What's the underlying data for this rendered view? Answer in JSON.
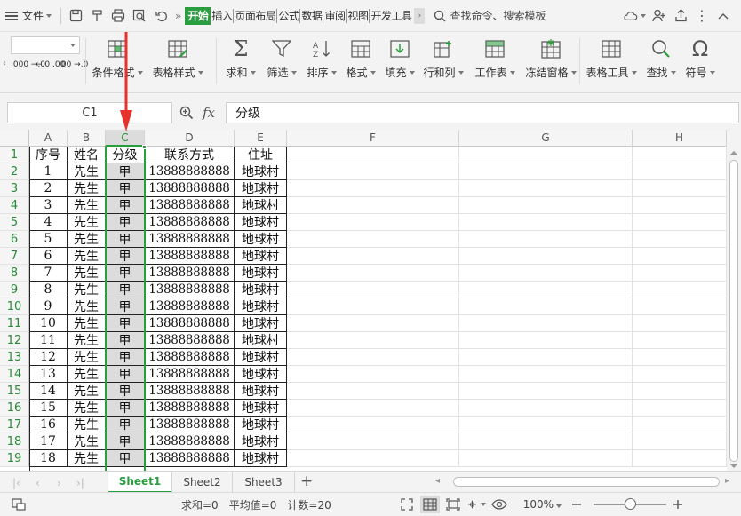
{
  "menubar": {
    "file_label": "文件",
    "tabs": [
      "开始",
      "插入",
      "页面布局",
      "公式",
      "数据",
      "审阅",
      "视图",
      "开发工具"
    ],
    "active_tab": "开始",
    "more": "»",
    "search_label": "查找命令、搜索模板"
  },
  "ribbon": {
    "num_formats": [
      ".000 →.0",
      "←.0 .00",
      ".00 →.0"
    ],
    "buttons": [
      {
        "id": "conditional-format",
        "label": "条件格式",
        "icon": "conditional-format-icon"
      },
      {
        "id": "table-style",
        "label": "表格样式",
        "icon": "table-style-icon"
      },
      {
        "id": "sum",
        "label": "求和",
        "icon": "sigma-icon"
      },
      {
        "id": "filter",
        "label": "筛选",
        "icon": "filter-icon"
      },
      {
        "id": "sort",
        "label": "排序",
        "icon": "sort-icon"
      },
      {
        "id": "format",
        "label": "格式",
        "icon": "format-icon"
      },
      {
        "id": "fill",
        "label": "填充",
        "icon": "fill-icon"
      },
      {
        "id": "row-col",
        "label": "行和列",
        "icon": "row-col-icon"
      },
      {
        "id": "worksheet",
        "label": "工作表",
        "icon": "worksheet-icon"
      },
      {
        "id": "freeze",
        "label": "冻结窗格",
        "icon": "freeze-icon"
      },
      {
        "id": "table-tools",
        "label": "表格工具",
        "icon": "table-tools-icon"
      },
      {
        "id": "find",
        "label": "查找",
        "icon": "magnifier-icon"
      },
      {
        "id": "symbol",
        "label": "符号",
        "icon": "omega-icon"
      }
    ]
  },
  "formula_bar": {
    "cell_ref": "C1",
    "fx_label": "fx",
    "value": "分级"
  },
  "grid": {
    "columns": [
      "A",
      "B",
      "C",
      "D",
      "E",
      "F",
      "G",
      "H"
    ],
    "selected_column": "C",
    "row_numbers": [
      "1",
      "2",
      "3",
      "4",
      "5",
      "6",
      "7",
      "8",
      "9",
      "10",
      "11",
      "12",
      "13",
      "14",
      "15",
      "16",
      "17",
      "18",
      "19"
    ],
    "header_row": [
      "序号",
      "姓名",
      "分级",
      "联系方式",
      "住址"
    ],
    "rows": [
      [
        "1",
        "先生",
        "甲",
        "13888888888",
        "地球村"
      ],
      [
        "2",
        "先生",
        "甲",
        "13888888888",
        "地球村"
      ],
      [
        "3",
        "先生",
        "甲",
        "13888888888",
        "地球村"
      ],
      [
        "4",
        "先生",
        "甲",
        "13888888888",
        "地球村"
      ],
      [
        "5",
        "先生",
        "甲",
        "13888888888",
        "地球村"
      ],
      [
        "6",
        "先生",
        "甲",
        "13888888888",
        "地球村"
      ],
      [
        "7",
        "先生",
        "甲",
        "13888888888",
        "地球村"
      ],
      [
        "8",
        "先生",
        "甲",
        "13888888888",
        "地球村"
      ],
      [
        "9",
        "先生",
        "甲",
        "13888888888",
        "地球村"
      ],
      [
        "10",
        "先生",
        "甲",
        "13888888888",
        "地球村"
      ],
      [
        "11",
        "先生",
        "甲",
        "13888888888",
        "地球村"
      ],
      [
        "12",
        "先生",
        "甲",
        "13888888888",
        "地球村"
      ],
      [
        "13",
        "先生",
        "甲",
        "13888888888",
        "地球村"
      ],
      [
        "14",
        "先生",
        "甲",
        "13888888888",
        "地球村"
      ],
      [
        "15",
        "先生",
        "甲",
        "13888888888",
        "地球村"
      ],
      [
        "16",
        "先生",
        "甲",
        "13888888888",
        "地球村"
      ],
      [
        "17",
        "先生",
        "甲",
        "13888888888",
        "地球村"
      ],
      [
        "18",
        "先生",
        "甲",
        "13888888888",
        "地球村"
      ]
    ]
  },
  "sheets": {
    "tabs": [
      "Sheet1",
      "Sheet2",
      "Sheet3"
    ],
    "active": "Sheet1",
    "add_label": "+"
  },
  "statusbar": {
    "sum": "求和=0",
    "average": "平均值=0",
    "count": "计数=20",
    "zoom": "100%",
    "zoom_fraction": 0.5
  },
  "colors": {
    "accent": "#2a9d3f",
    "arrow": "#e5322d",
    "selected_col_fill": "#dcdcdc"
  }
}
